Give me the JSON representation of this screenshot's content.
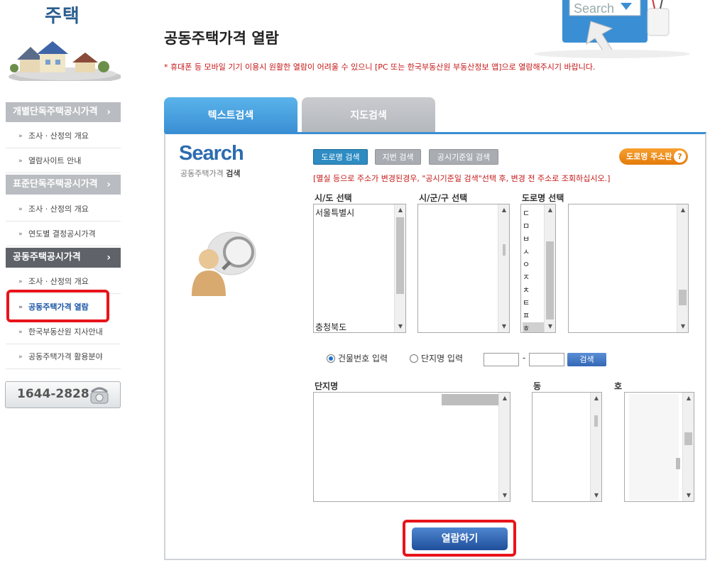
{
  "sidebar": {
    "title": "주택",
    "groups": [
      {
        "head": "개별단독주택공시가격",
        "items": [
          "조사 · 산정의 개요",
          "열람사이트 안내"
        ]
      },
      {
        "head": "표준단독주택공시가격",
        "items": [
          "조사 · 산정의 개요",
          "연도별 결정공시가격"
        ]
      },
      {
        "head": "공동주택공시가격",
        "items": [
          "조사 · 산정의 개요",
          "공동주택가격 열람",
          "한국부동산원 지사안내",
          "공동주택가격 활용분야"
        ]
      }
    ],
    "chevron": "›",
    "bullet": "»",
    "phone": "1644-2828"
  },
  "header": {
    "title": "공동주택가격 열람",
    "notice": "* 휴대폰 등 모바일 기기 이용시 원활한 열람이 어려울 수 있으니 [PC 또는 한국부동산원 부동산정보 앱]으로 열람해주시기 바랍니다.",
    "deco_text": "Search"
  },
  "tabs": [
    "텍스트검색",
    "지도검색"
  ],
  "search": {
    "logo": "Search",
    "sub_normal": "공동주택가격",
    "sub_bold": "검색",
    "mode_buttons": [
      "도로명 검색",
      "지번 검색",
      "공시기준일 검색"
    ],
    "road_btn": "도로명 주소란",
    "road_btn_q": "?",
    "hint": "[멸실 등으로 주소가 변경된경우, \"공시기준일 검색\"선택 후, 변경 전 주소로 조회하십시오.]",
    "labels": {
      "sido": "시/도 선택",
      "sigungu": "시/군/구 선택",
      "road": "도로명 선택"
    },
    "sido_first": "서울특별시",
    "sido_last": "충청북도",
    "jamo": [
      "ㄷ",
      "ㅁ",
      "ㅂ",
      "ㅅ",
      "ㅇ",
      "ㅈ",
      "ㅊ",
      "ㅌ",
      "ㅍ",
      "ㅎ"
    ],
    "radio_building": "건물번호 입력",
    "radio_complex": "단지명 입력",
    "dash": "-",
    "find_btn": "검색",
    "danji_label": "단지명",
    "dong_label": "동",
    "ho_label": "호",
    "view_btn": "열람하기"
  },
  "colors": {
    "accent": "#3a8fd4",
    "red_highlight": "#e8141b",
    "notice": "#c61717",
    "orange": "#e37b09"
  }
}
